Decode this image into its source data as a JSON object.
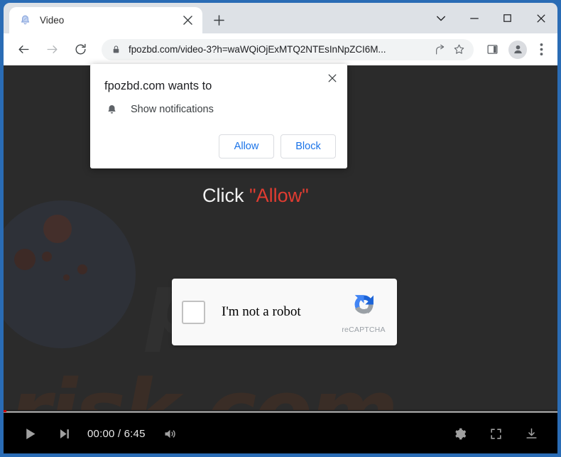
{
  "window": {
    "buttons": [
      {
        "name": "tab-search-button",
        "icon": "chevron-down-icon",
        "label": ""
      },
      {
        "name": "minimize-button",
        "icon": "minimize-icon",
        "label": ""
      },
      {
        "name": "maximize-button",
        "icon": "maximize-icon",
        "label": ""
      },
      {
        "name": "close-button",
        "icon": "close-icon",
        "label": ""
      }
    ]
  },
  "tabstrip": {
    "tab": {
      "title": "Video",
      "favicon": "bell-icon",
      "close_label": "×"
    },
    "new_tab_label": "+"
  },
  "toolbar": {
    "back_icon": "back-arrow-icon",
    "forward_icon": "forward-arrow-icon",
    "reload_icon": "reload-icon",
    "url": "fpozbd.com/video-3?h=waWQiOjExMTQ2NTEsInNpZCI6M...",
    "lock_icon": "lock-icon",
    "share_icon": "share-icon",
    "star_icon": "star-icon",
    "side_panel_icon": "side-panel-icon",
    "profile_icon": "profile-avatar-icon",
    "menu_icon": "three-dot-menu-icon"
  },
  "permission_dialog": {
    "title": "fpozbd.com wants to",
    "item_label": "Show notifications",
    "item_icon": "bell-icon",
    "allow_label": "Allow",
    "block_label": "Block",
    "close_label": "×"
  },
  "page": {
    "instruction_prefix": "Click ",
    "instruction_highlight": "\"Allow\"",
    "watermark": "risk.com",
    "watermark_top": "p",
    "background_color": "#2b2b2b",
    "highlight_color": "#e03c31"
  },
  "recaptcha": {
    "label": "I'm not a robot",
    "brand": "reCAPTCHA",
    "checkbox_checked": false
  },
  "player": {
    "play_icon": "play-icon",
    "next_icon": "next-track-icon",
    "volume_icon": "volume-icon",
    "settings_icon": "gear-icon",
    "fullscreen_icon": "fullscreen-icon",
    "download_icon": "download-icon",
    "current_time": "00:00",
    "duration": "6:45",
    "time_display": "00:00 / 6:45",
    "progress_percent": 0
  }
}
